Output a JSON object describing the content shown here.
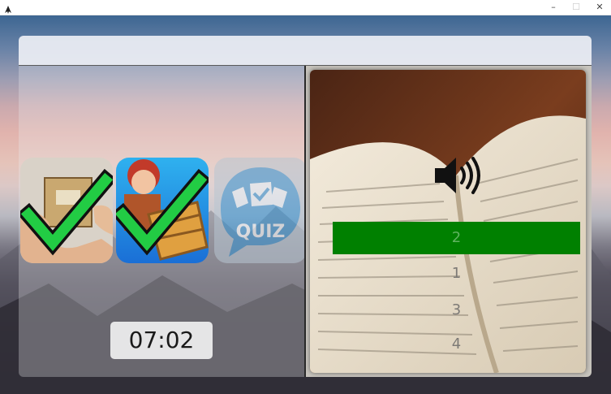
{
  "window": {
    "minimize_glyph": "–",
    "maximize_glyph": "☐",
    "close_glyph": "✕",
    "app_icon": "app-icon"
  },
  "games": [
    {
      "name": "hands-box-game",
      "completed": true,
      "icon": "hands-box-icon"
    },
    {
      "name": "boy-crate-game",
      "completed": true,
      "icon": "boy-crate-icon"
    },
    {
      "name": "quiz-game",
      "completed": false,
      "icon": "quiz-icon",
      "label": "QUIZ"
    }
  ],
  "timer": {
    "value": "07:02"
  },
  "audio": {
    "icon": "speaker-icon"
  },
  "answers": [
    {
      "label": "2",
      "selected": true
    },
    {
      "label": "1",
      "selected": false
    },
    {
      "label": "3",
      "selected": false
    },
    {
      "label": "4",
      "selected": false
    }
  ],
  "colors": {
    "check": "#22cc44",
    "selected_answer": "#008000",
    "quiz_bubble": "#2f8fd0"
  }
}
